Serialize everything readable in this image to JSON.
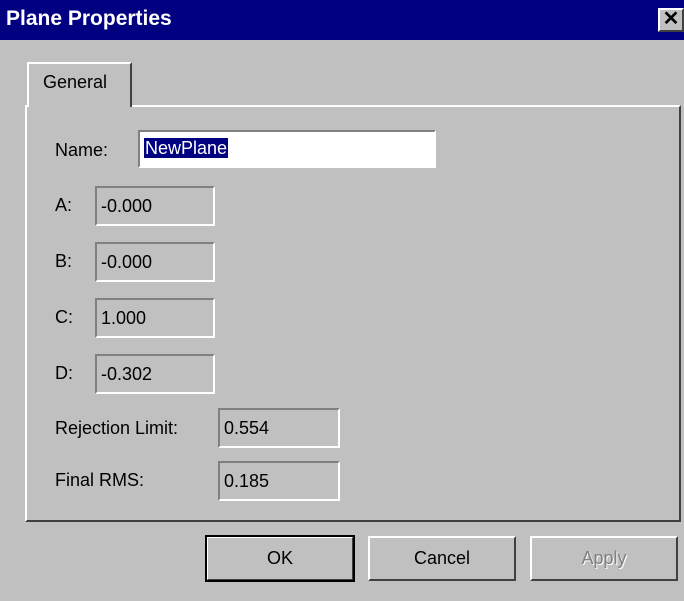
{
  "window": {
    "title": "Plane Properties",
    "close_glyph": "✕"
  },
  "tabs": [
    {
      "label": "General"
    }
  ],
  "form": {
    "name_label": "Name:",
    "name_value": "NewPlane",
    "a_label": "A:",
    "a_value": "-0.000",
    "b_label": "B:",
    "b_value": "-0.000",
    "c_label": "C:",
    "c_value": "1.000",
    "d_label": "D:",
    "d_value": "-0.302",
    "rejection_label": "Rejection Limit:",
    "rejection_value": "0.554",
    "rms_label": "Final RMS:",
    "rms_value": "0.185"
  },
  "buttons": {
    "ok": "OK",
    "cancel": "Cancel",
    "apply": "Apply"
  },
  "colors": {
    "titlebar": "#000080",
    "face": "#c0c0c0",
    "selection": "#000080"
  }
}
